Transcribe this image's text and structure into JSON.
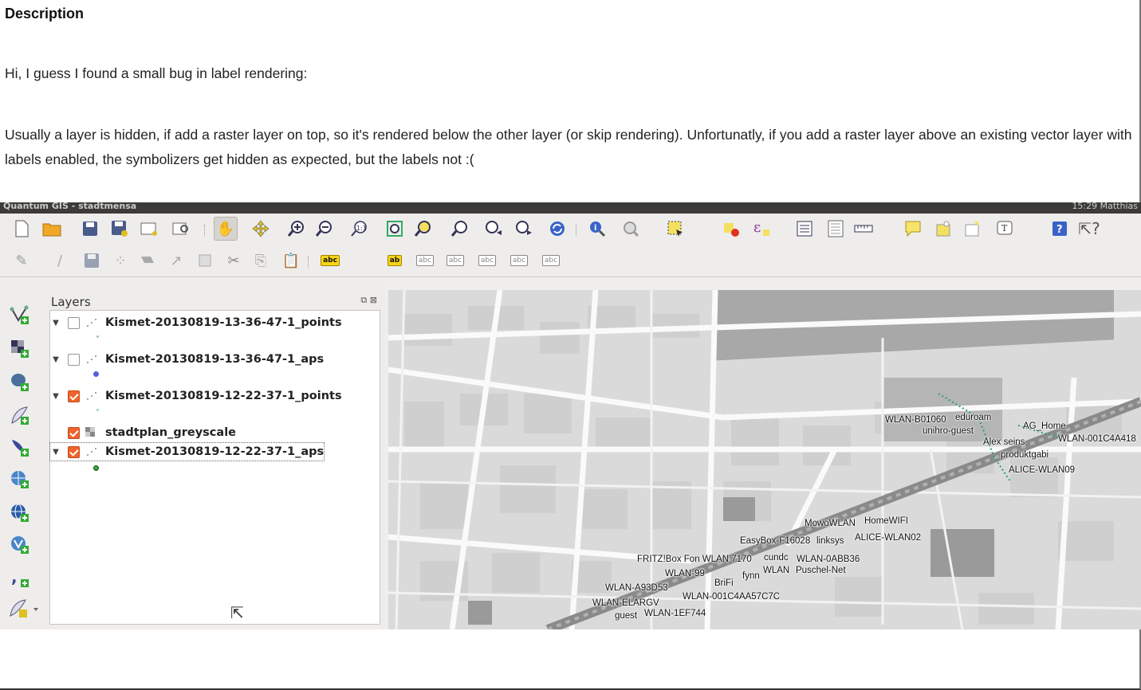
{
  "description": {
    "title": "Description",
    "paragraph1": "Hi, I guess I found a small bug in label rendering:",
    "paragraph2": "Usually a layer is hidden, if add a raster layer on top, so it's rendered below the other layer (or skip rendering). Unfortunatly, if you add a raster layer above an existing vector layer with labels enabled, the symbolizers get hidden as expected, but the labels not :("
  },
  "window": {
    "title": "Quantum GIS - stadtmensa",
    "tray_time": "15:29",
    "tray_user": "Matthias"
  },
  "toolbar1": {
    "icons": [
      "new-project-icon",
      "open-project-icon",
      "save-project-icon",
      "save-as-icon",
      "print-composer-icon",
      "composer-manager-icon",
      "pan-icon",
      "pan-to-selection-icon",
      "zoom-in-icon",
      "zoom-out-icon",
      "zoom-native-icon",
      "zoom-full-icon",
      "zoom-to-selection-icon",
      "zoom-to-layer-icon",
      "zoom-last-icon",
      "zoom-next-icon",
      "refresh-icon",
      "identify-icon",
      "action-icon",
      "select-icon",
      "deselect-icon",
      "expression-select-icon",
      "attribute-table-icon",
      "statistics-icon",
      "measure-icon",
      "map-tips-icon",
      "new-bookmark-icon",
      "show-bookmarks-icon",
      "text-annotation-icon",
      "help-icon",
      "whats-this-icon"
    ]
  },
  "toolbar2": {
    "label_buttons": [
      "abc",
      "ab",
      "abc",
      "abc",
      "abc",
      "abc",
      "abc"
    ]
  },
  "layers_panel": {
    "title": "Layers",
    "layers": [
      {
        "name": "Kismet-20130819-13-36-47-1_points",
        "checked": false,
        "type": "points",
        "symbol_color": "#9cc0c0"
      },
      {
        "name": "Kismet-20130819-13-36-47-1_aps",
        "checked": false,
        "type": "points",
        "symbol_color": "#5a5ae0"
      },
      {
        "name": "Kismet-20130819-12-22-37-1_points",
        "checked": true,
        "type": "points",
        "symbol_color": "#9cd0c0"
      },
      {
        "name": "stadtplan_greyscale",
        "checked": true,
        "type": "raster",
        "symbol_color": ""
      },
      {
        "name": "Kismet-20130819-12-22-37-1_aps",
        "checked": true,
        "type": "points",
        "symbol_color": "#3fa33f"
      }
    ]
  },
  "map_labels": [
    "WLAN-B01060",
    "eduroam",
    "unihro-guest",
    "AG_Home",
    "Alex seins",
    "WLAN-001C4A418",
    "produktgabi",
    "ALICE-WLAN09",
    "MowoWLAN",
    "HomeWIFI",
    "EasyBox-F16028",
    "linksys",
    "ALICE-WLAN02",
    "FRITZ!Box Fon WLAN 7170",
    "cundc",
    "WLAN-0ABB36",
    "WLAN-99",
    "fynn",
    "WLAN",
    "Puschel-Net",
    "WLAN-A93D53",
    "BriFi",
    "WLAN-001C4AA57C7C",
    "WLAN-ELARGV",
    "guest",
    "WLAN-1EF744"
  ],
  "colors": {
    "accent_checkbox": "#f0642c",
    "map_background": "#dcdcdc",
    "toolbar_bg": "#eeedeb"
  }
}
